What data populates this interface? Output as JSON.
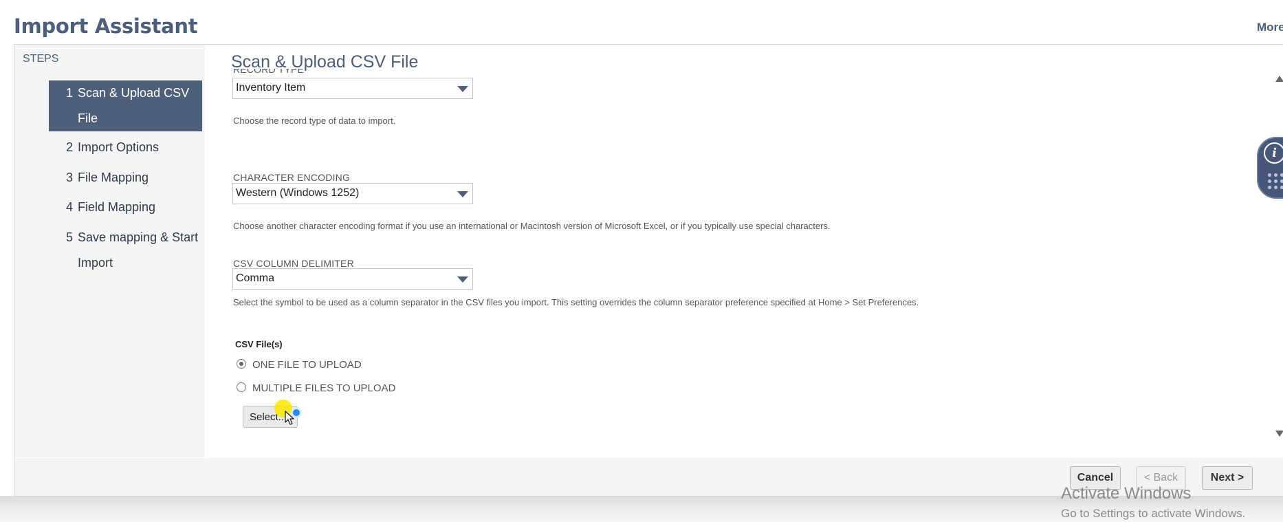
{
  "header": {
    "title": "Import Assistant",
    "more_label": "More"
  },
  "steps": {
    "heading": "STEPS",
    "items": [
      {
        "num": "1",
        "label": "Scan & Upload CSV File",
        "active": true
      },
      {
        "num": "2",
        "label": "Import Options"
      },
      {
        "num": "3",
        "label": "File Mapping"
      },
      {
        "num": "4",
        "label": "Field Mapping"
      },
      {
        "num": "5",
        "label": "Save mapping & Start Import"
      }
    ]
  },
  "main": {
    "title": "Scan & Upload CSV File",
    "record_type": {
      "label": "RECORD TYPE",
      "value": "Inventory Item",
      "help": "Choose the record type of data to import."
    },
    "character_encoding": {
      "label": "CHARACTER ENCODING",
      "value": "Western (Windows 1252)",
      "help": "Choose another character encoding format if you use an international or Macintosh version of Microsoft Excel, or if you typically use special characters."
    },
    "delimiter": {
      "label": "CSV COLUMN DELIMITER",
      "value": "Comma",
      "help": "Select the symbol to be used as a column separator in the CSV files you import. This setting overrides the column separator preference specified at Home > Set Preferences."
    },
    "csv_files": {
      "heading": "CSV File(s)",
      "options": [
        {
          "label": "ONE FILE TO UPLOAD",
          "selected": true
        },
        {
          "label": "MULTIPLE FILES TO UPLOAD",
          "selected": false
        }
      ],
      "select_button": "Select..."
    }
  },
  "side_widget": {
    "icons": [
      "info-icon",
      "grid-icon"
    ]
  },
  "footer": {
    "cancel": "Cancel",
    "back": "< Back",
    "next": "Next >"
  },
  "watermark": {
    "title": "Activate Windows",
    "subtitle": "Go to Settings to activate Windows."
  }
}
